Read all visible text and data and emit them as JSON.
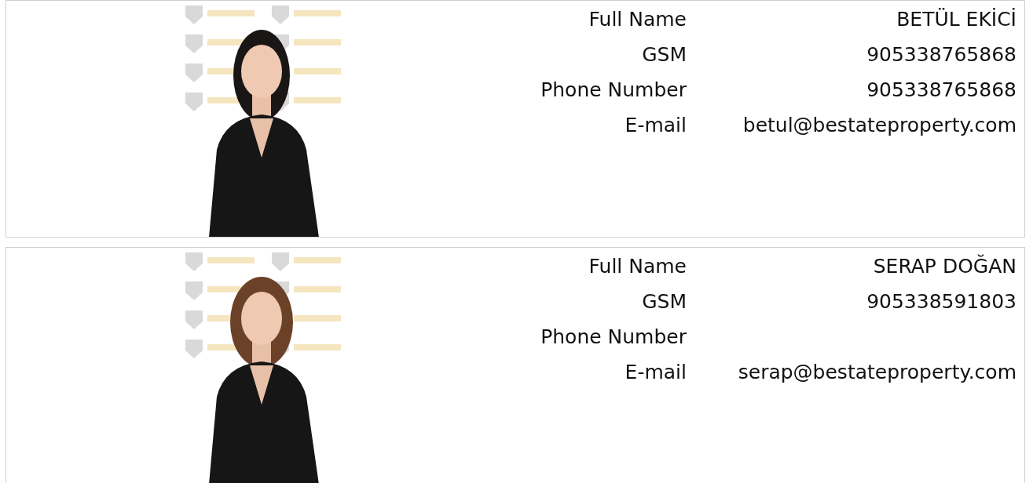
{
  "agents": [
    {
      "fields": [
        {
          "label": "Full Name",
          "value": "BETÜL EKİCİ"
        },
        {
          "label": "GSM",
          "value": "905338765868"
        },
        {
          "label": "Phone Number",
          "value": "905338765868"
        },
        {
          "label": "E-mail",
          "value": "betul@bestateproperty.com"
        }
      ]
    },
    {
      "fields": [
        {
          "label": "Full Name",
          "value": "SERAP DOĞAN"
        },
        {
          "label": "GSM",
          "value": "905338591803"
        },
        {
          "label": "Phone Number"
        },
        {
          "label": "E-mail",
          "value": "serap@bestateproperty.com"
        }
      ]
    }
  ]
}
